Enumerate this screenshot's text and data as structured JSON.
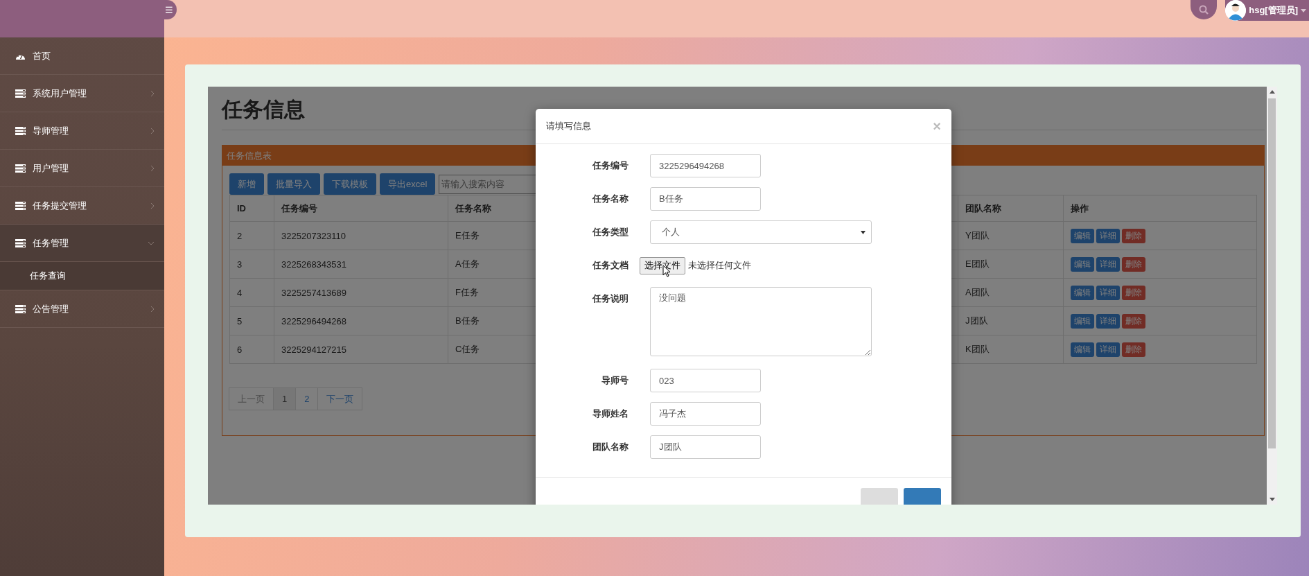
{
  "header": {
    "menu_toggle": "☰",
    "user": "hsg[管理员]"
  },
  "sidebar": {
    "items": [
      {
        "label": "首页",
        "kind": "home",
        "expanded": false
      },
      {
        "label": "系统用户管理",
        "kind": "menu",
        "expanded": false
      },
      {
        "label": "导师管理",
        "kind": "menu",
        "expanded": false
      },
      {
        "label": "用户管理",
        "kind": "menu",
        "expanded": false
      },
      {
        "label": "任务提交管理",
        "kind": "menu",
        "expanded": false
      },
      {
        "label": "任务管理",
        "kind": "menu",
        "expanded": true,
        "children": [
          {
            "label": "任务查询"
          }
        ]
      },
      {
        "label": "公告管理",
        "kind": "menu",
        "expanded": false
      }
    ]
  },
  "page": {
    "title": "任务信息",
    "panel_title": "任务信息表",
    "toolbar": [
      "新增",
      "批量导入",
      "下载模板",
      "导出excel"
    ],
    "search": {
      "placeholder": "请输入搜索内容"
    },
    "table": {
      "columns": [
        "ID",
        "任务编号",
        "任务名称",
        "团队名称",
        "操作"
      ],
      "rows": [
        {
          "cells": [
            "2",
            "3225207323110",
            "E任务",
            "Y团队"
          ],
          "actions": [
            {
              "label": "编辑",
              "kind": "primary"
            },
            {
              "label": "详细",
              "kind": "primary"
            },
            {
              "label": "删除",
              "kind": "danger"
            }
          ]
        },
        {
          "cells": [
            "3",
            "3225268343531",
            "A任务",
            "E团队"
          ],
          "actions": [
            {
              "label": "编辑",
              "kind": "primary"
            },
            {
              "label": "详细",
              "kind": "primary"
            },
            {
              "label": "删除",
              "kind": "danger"
            }
          ]
        },
        {
          "cells": [
            "4",
            "3225257413689",
            "F任务",
            "A团队"
          ],
          "actions": [
            {
              "label": "编辑",
              "kind": "primary"
            },
            {
              "label": "详细",
              "kind": "primary"
            },
            {
              "label": "删除",
              "kind": "danger"
            }
          ]
        },
        {
          "cells": [
            "5",
            "3225296494268",
            "B任务",
            "J团队"
          ],
          "actions": [
            {
              "label": "编辑",
              "kind": "primary"
            },
            {
              "label": "详细",
              "kind": "primary"
            },
            {
              "label": "删除",
              "kind": "danger"
            }
          ]
        },
        {
          "cells": [
            "6",
            "3225294127215",
            "C任务",
            "K团队"
          ],
          "actions": [
            {
              "label": "编辑",
              "kind": "primary"
            },
            {
              "label": "详细",
              "kind": "primary"
            },
            {
              "label": "删除",
              "kind": "danger"
            }
          ]
        }
      ]
    },
    "pagination": [
      {
        "label": "上一页",
        "selected": false,
        "disabled": true
      },
      {
        "label": "1",
        "selected": true,
        "disabled": false
      },
      {
        "label": "2",
        "selected": false,
        "disabled": false
      },
      {
        "label": "下一页",
        "selected": false,
        "disabled": false
      }
    ]
  },
  "modal": {
    "title": "请填写信息",
    "close": "×",
    "fields": [
      {
        "label": "任务编号",
        "kind": "input",
        "value": "3225296494268"
      },
      {
        "label": "任务名称",
        "kind": "input",
        "value": "B任务"
      },
      {
        "label": "任务类型",
        "kind": "select",
        "value": "个人"
      },
      {
        "label": "任务文档",
        "kind": "file",
        "button": "选择文件",
        "status": "未选择任何文件"
      },
      {
        "label": "任务说明",
        "kind": "textarea",
        "value": "没问题"
      },
      {
        "label": "导师号",
        "kind": "input",
        "value": "023"
      },
      {
        "label": "导师姓名",
        "kind": "input",
        "value": "冯子杰"
      },
      {
        "label": "团队名称",
        "kind": "input",
        "value": "J团队"
      }
    ],
    "footer_buttons": [
      {
        "kind": "default"
      },
      {
        "kind": "primary"
      }
    ]
  }
}
